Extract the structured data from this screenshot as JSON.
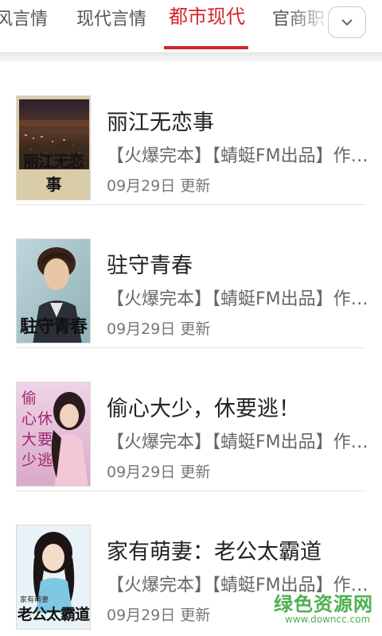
{
  "tabs": [
    {
      "label": "风言情"
    },
    {
      "label": "现代言情"
    },
    {
      "label": "都市现代"
    },
    {
      "label": "官商职"
    }
  ],
  "active_tab_index": 2,
  "more_icon": "chevron-down-icon",
  "colors": {
    "accent": "#d3262c",
    "watermark": "#4eb14f"
  },
  "books": [
    {
      "title": "丽江无恋事",
      "desc": "【火爆完本】【蜻蜓FM出品】作者...",
      "date": "09月29日 更新",
      "cover_text": "丽江无恋事"
    },
    {
      "title": "驻守青春",
      "desc": "【火爆完本】【蜻蜓FM出品】作者...",
      "date": "09月29日 更新",
      "cover_text": "駐守青春"
    },
    {
      "title": "偷心大少，休要逃！",
      "desc": "【火爆完本】【蜻蜓FM出品】作者...",
      "date": "09月29日 更新",
      "cover_text": "偷心大少休要逃"
    },
    {
      "title": "家有萌妻：老公太霸道",
      "desc": "【火爆完本】【蜻蜓FM出品】作者...",
      "date": "09月29日 更新",
      "cover_text": "老公太霸道"
    }
  ],
  "cover_extra": {
    "book4_small": "家有萌妻"
  },
  "watermark": {
    "text": "绿色资源网",
    "url": "www.downcc.com"
  }
}
